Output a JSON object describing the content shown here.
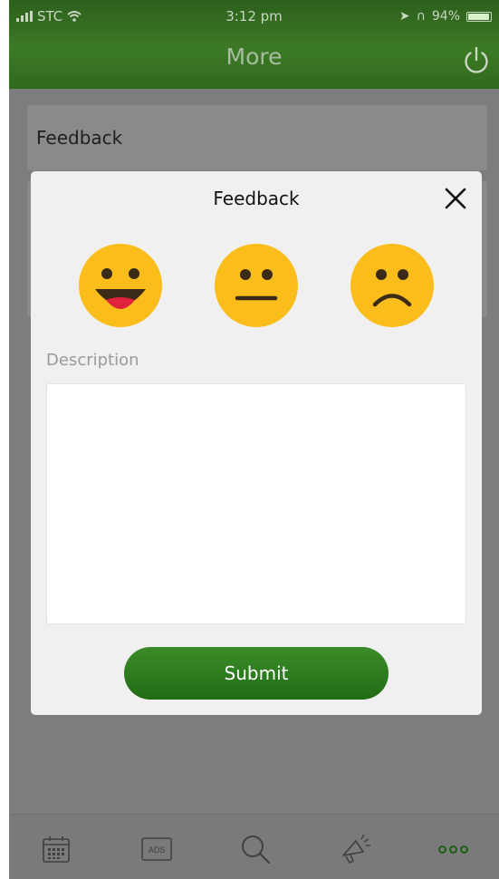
{
  "status_bar": {
    "carrier": "STC",
    "time": "3:12 pm",
    "battery": "94%",
    "battery_level": 0.94
  },
  "header": {
    "title": "More",
    "power_icon": "power-icon"
  },
  "list": {
    "items": [
      {
        "label": "Feedback"
      }
    ]
  },
  "modal": {
    "title": "Feedback",
    "close_icon": "close-icon",
    "ratings": [
      {
        "icon": "happy-face-icon"
      },
      {
        "icon": "neutral-face-icon"
      },
      {
        "icon": "sad-face-icon"
      }
    ],
    "description_label": "Description",
    "description_value": "",
    "submit_label": "Submit"
  },
  "tab_bar": {
    "tabs": [
      {
        "icon": "calendar-icon"
      },
      {
        "icon": "ads-icon",
        "label": "ADS"
      },
      {
        "icon": "search-icon"
      },
      {
        "icon": "megaphone-icon"
      },
      {
        "icon": "more-icon",
        "active": true
      }
    ]
  },
  "colors": {
    "header_green": "#3d7a25",
    "submit_green": "#2a7a1c",
    "emoji_yellow": "#fbbd1c",
    "tongue_red": "#e0223c"
  }
}
